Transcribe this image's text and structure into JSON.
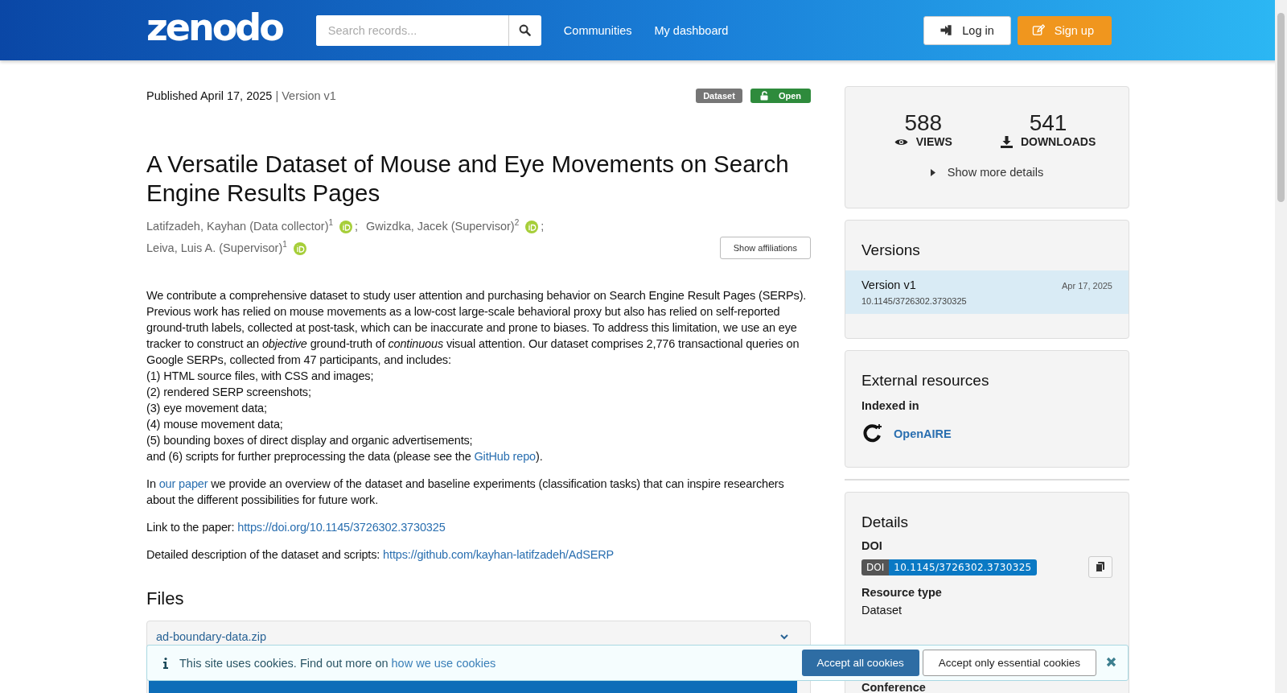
{
  "header": {
    "logo": "zenodo",
    "search": {
      "placeholder": "Search records..."
    },
    "nav": [
      "Communities",
      "My dashboard"
    ],
    "login": "Log in",
    "signup": "Sign up"
  },
  "record": {
    "published": "Published April 17, 2025",
    "version": "| Version v1",
    "badges": [
      {
        "label": "Dataset",
        "kind": "type"
      },
      {
        "label": "Open",
        "kind": "access"
      }
    ],
    "title": "A Versatile Dataset of Mouse and Eye Movements on Search Engine Results Pages",
    "creators": [
      {
        "name": "Latifzadeh, Kayhan (Data collector)",
        "aff": "1",
        "sep": ";"
      },
      {
        "name": "Gwizdka, Jacek (Supervisor)",
        "aff": "2",
        "sep": ";"
      },
      {
        "name": "Leiva, Luis A. (Supervisor)",
        "aff": "1"
      }
    ],
    "show_affiliations": "Show affiliations",
    "description": [
      [
        {
          "kind": "text",
          "text": "We contribute a comprehensive dataset to study user attention and purchasing behavior on Search Engine Result Pages (SERPs). Previous work has relied on mouse movements as a low-cost large-scale behavioral proxy but also has relied on self-reported ground-truth labels, collected at post-task, which can be inaccurate and prone to biases. To address this limitation, we use an eye tracker to construct an *objective* ground-truth of *continuous* visual attention. Our dataset comprises 2,776 transactional queries on Google SERPs, collected from 47 participants, and includes:\n(1) HTML source files, with CSS and images;\n(2) rendered SERP screenshots;\n(3) eye movement data;\n(4) mouse movement data;\n(5) bounding boxes of direct display and organic advertisements;\nand (6) scripts for further preprocessing the data (please see the "
        },
        {
          "kind": "link",
          "text": "GitHub repo"
        },
        {
          "kind": "text",
          "text": ")."
        }
      ],
      [
        {
          "kind": "text",
          "text": "In "
        },
        {
          "kind": "link",
          "text": "our paper"
        },
        {
          "kind": "text",
          "text": " we provide an overview of the dataset and baseline experiments (classification tasks) that can inspire researchers about the different possibilities for future work."
        }
      ],
      [
        {
          "kind": "text",
          "text": "Link to the paper: "
        },
        {
          "kind": "link",
          "text": "https://doi.org/10.1145/3726302.3730325"
        }
      ],
      [
        {
          "kind": "text",
          "text": "Detailed description of the dataset and scripts: "
        },
        {
          "kind": "link",
          "text": "https://github.com/kayhan-latifzadeh/AdSERP"
        }
      ]
    ],
    "files_heading": "Files",
    "files": [
      {
        "name": "ad-boundary-data.zip",
        "expanded": true
      }
    ]
  },
  "sidebar": {
    "stats": [
      {
        "value": "588",
        "label": "VIEWS",
        "kind": "views"
      },
      {
        "value": "541",
        "label": "DOWNLOADS",
        "kind": "downloads"
      }
    ],
    "more": "Show more details",
    "versions": {
      "heading": "Versions",
      "items": [
        {
          "title": "Version v1",
          "date": "Apr 17, 2025",
          "doi": "10.1145/3726302.3730325",
          "selected": true
        }
      ]
    },
    "external": {
      "heading": "External resources",
      "sub": "Indexed in",
      "link": "OpenAIRE"
    },
    "details": {
      "heading": "Details",
      "doi_label": "DOI",
      "doi_tag": "DOI",
      "doi": "10.1145/3726302.3730325",
      "resource_label": "Resource type",
      "resource": "Dataset",
      "next_label": "Conference"
    }
  },
  "cookies": {
    "text": "This site uses cookies. Find out more on ",
    "link": "how we use cookies",
    "accept_all": "Accept all cookies",
    "accept_essential": "Accept only essential cookies"
  }
}
